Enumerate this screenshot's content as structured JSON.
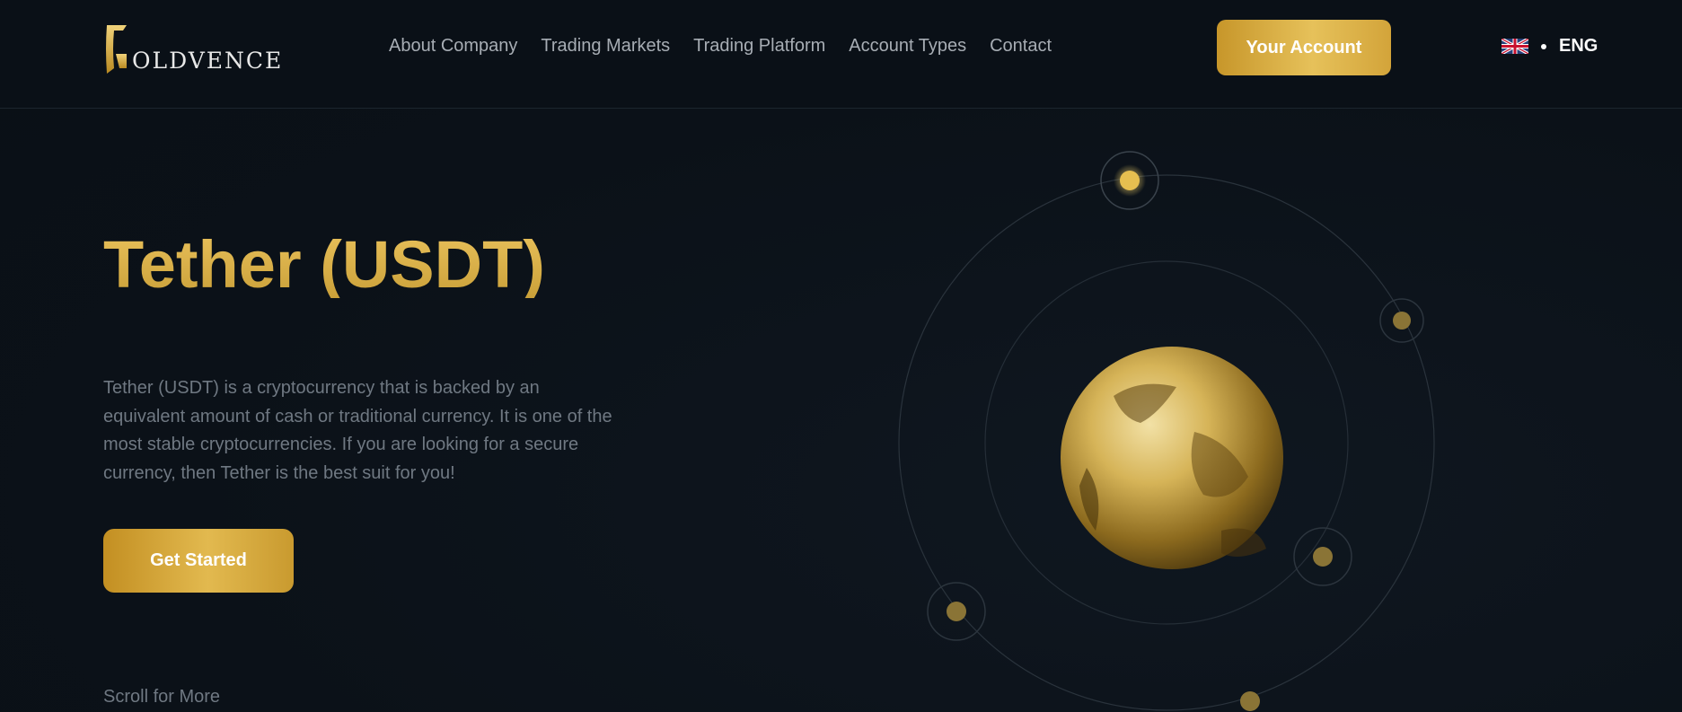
{
  "brand": {
    "logo_text": "OLDVENCE",
    "logo_letter": "G"
  },
  "nav": {
    "items": [
      {
        "label": "About Company"
      },
      {
        "label": "Trading Markets"
      },
      {
        "label": "Trading Platform"
      },
      {
        "label": "Account Types"
      },
      {
        "label": "Contact"
      }
    ]
  },
  "header": {
    "account_button": "Your Account",
    "language": "ENG",
    "flag_icon": "uk-flag-icon"
  },
  "hero": {
    "title": "Tether (USDT)",
    "description": "Tether (USDT) is a cryptocurrency that is backed by an equivalent amount of cash or traditional currency. It is one of the most stable cryptocurrencies. If you are looking for a secure currency, then Tether is the best suit for you!",
    "cta": "Get Started",
    "scroll_text": "Scroll for More"
  },
  "colors": {
    "gold": "#d9ae42",
    "background": "#0b1118",
    "nav_text": "#a7adb4"
  }
}
